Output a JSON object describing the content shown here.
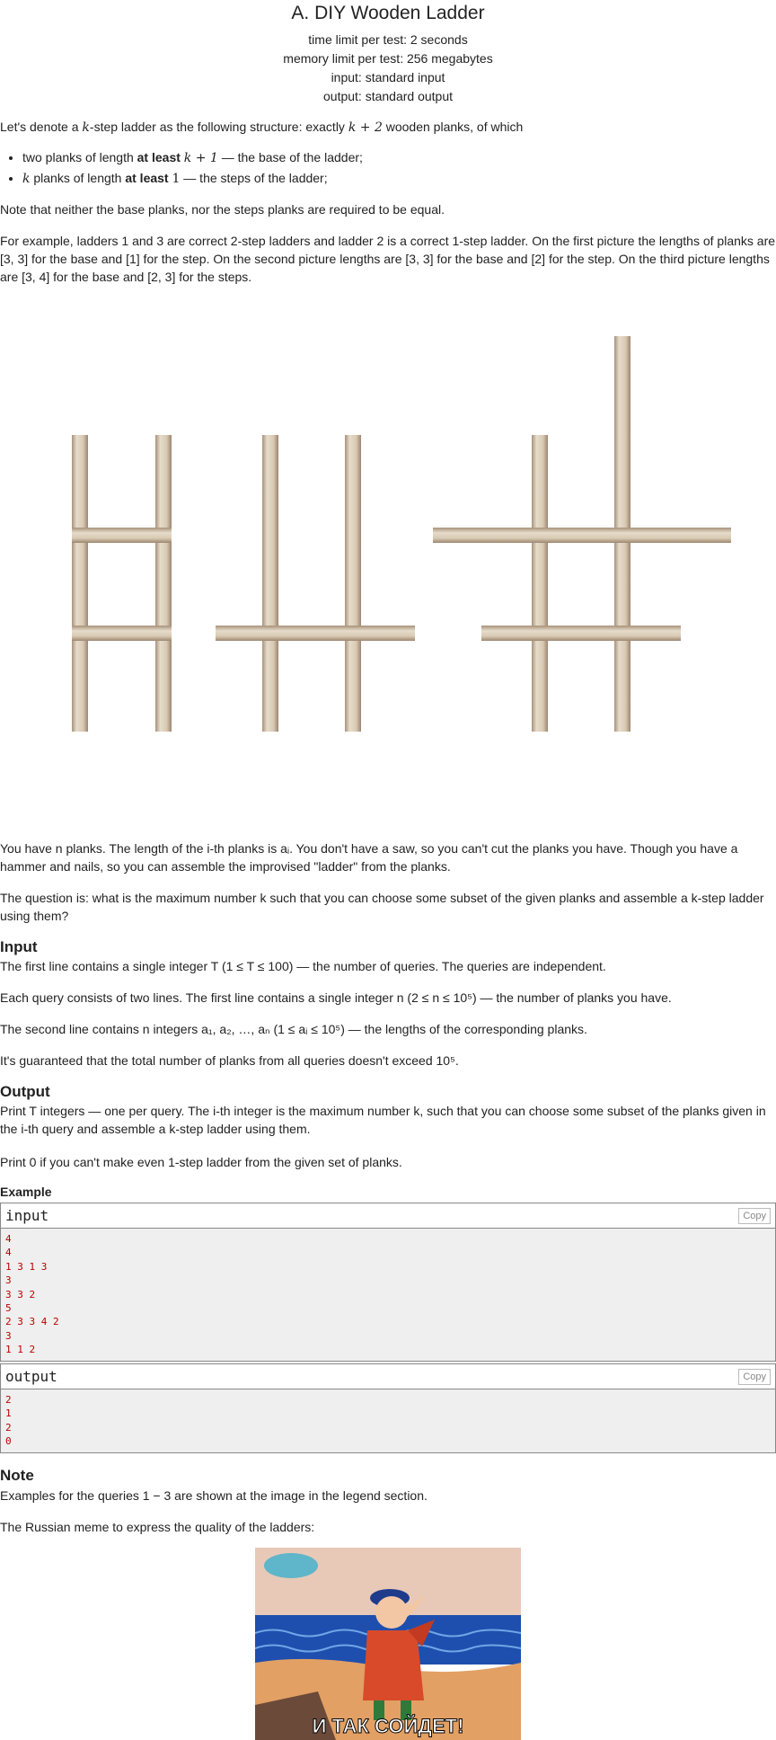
{
  "header": {
    "title": "A. DIY Wooden Ladder",
    "time_limit": "time limit per test: 2 seconds",
    "memory_limit": "memory limit per test: 256 megabytes",
    "input": "input: standard input",
    "output": "output: standard output"
  },
  "statement": {
    "intro_prefix": "Let's denote a ",
    "intro_k": "k",
    "intro_mid": "-step ladder as the following structure: exactly ",
    "intro_k2": "k + 2",
    "intro_suffix": " wooden planks, of which",
    "bullet1_pre": "two planks of length ",
    "bullet1_bold": "at least",
    "bullet1_math": "k + 1",
    "bullet1_post": " — the base of the ladder;",
    "bullet2_math": "k",
    "bullet2_pre": " planks of length ",
    "bullet2_bold": "at least",
    "bullet2_num": "1",
    "bullet2_post": " — the steps of the ladder;",
    "note_equal": "Note that neither the base planks, nor the steps planks are required to be equal.",
    "example_para": "For example, ladders 1 and 3 are correct 2-step ladders and ladder 2 is a correct 1-step ladder. On the first picture the lengths of planks are [3, 3] for the base and [1] for the step. On the second picture lengths are [3, 3] for the base and [2] for the step. On the third picture lengths are [3, 4] for the base and [2, 3] for the steps.",
    "have_planks": "You have n planks. The length of the i-th planks is aᵢ. You don't have a saw, so you can't cut the planks you have. Though you have a hammer and nails, so you can assemble the improvised \"ladder\" from the planks.",
    "question": "The question is: what is the maximum number k such that you can choose some subset of the given planks and assemble a k-step ladder using them?"
  },
  "input_section": {
    "heading": "Input",
    "p1": "The first line contains a single integer T (1 ≤ T ≤ 100) — the number of queries. The queries are independent.",
    "p2": "Each query consists of two lines. The first line contains a single integer n (2 ≤ n ≤ 10⁵) — the number of planks you have.",
    "p3": "The second line contains n integers a₁, a₂, …, aₙ (1 ≤ aᵢ ≤ 10⁵) — the lengths of the corresponding planks.",
    "p4": "It's guaranteed that the total number of planks from all queries doesn't exceed 10⁵."
  },
  "output_section": {
    "heading": "Output",
    "p1": "Print T integers — one per query. The i-th integer is the maximum number k, such that you can choose some subset of the planks given in the i-th query and assemble a k-step ladder using them.",
    "p2": "Print 0 if you can't make even 1-step ladder from the given set of planks."
  },
  "example": {
    "heading": "Example",
    "input_title": "input",
    "output_title": "output",
    "copy_label": "Copy",
    "input_text": "4\n4\n1 3 1 3\n3\n3 3 2\n5\n2 3 3 4 2\n3\n1 1 2",
    "output_text": "2\n1\n2\n0"
  },
  "note_section": {
    "heading": "Note",
    "p1": "Examples for the queries 1 − 3 are shown at the image in the legend section.",
    "p2": "The Russian meme to express the quality of the ladders:",
    "meme_caption": "И ТАК СОЙДЕТ!"
  },
  "colors": {
    "plank_light": "#e6dccb",
    "plank_dark": "#a8927a",
    "code_text": "#bb0000",
    "box_bg": "#efefef"
  }
}
